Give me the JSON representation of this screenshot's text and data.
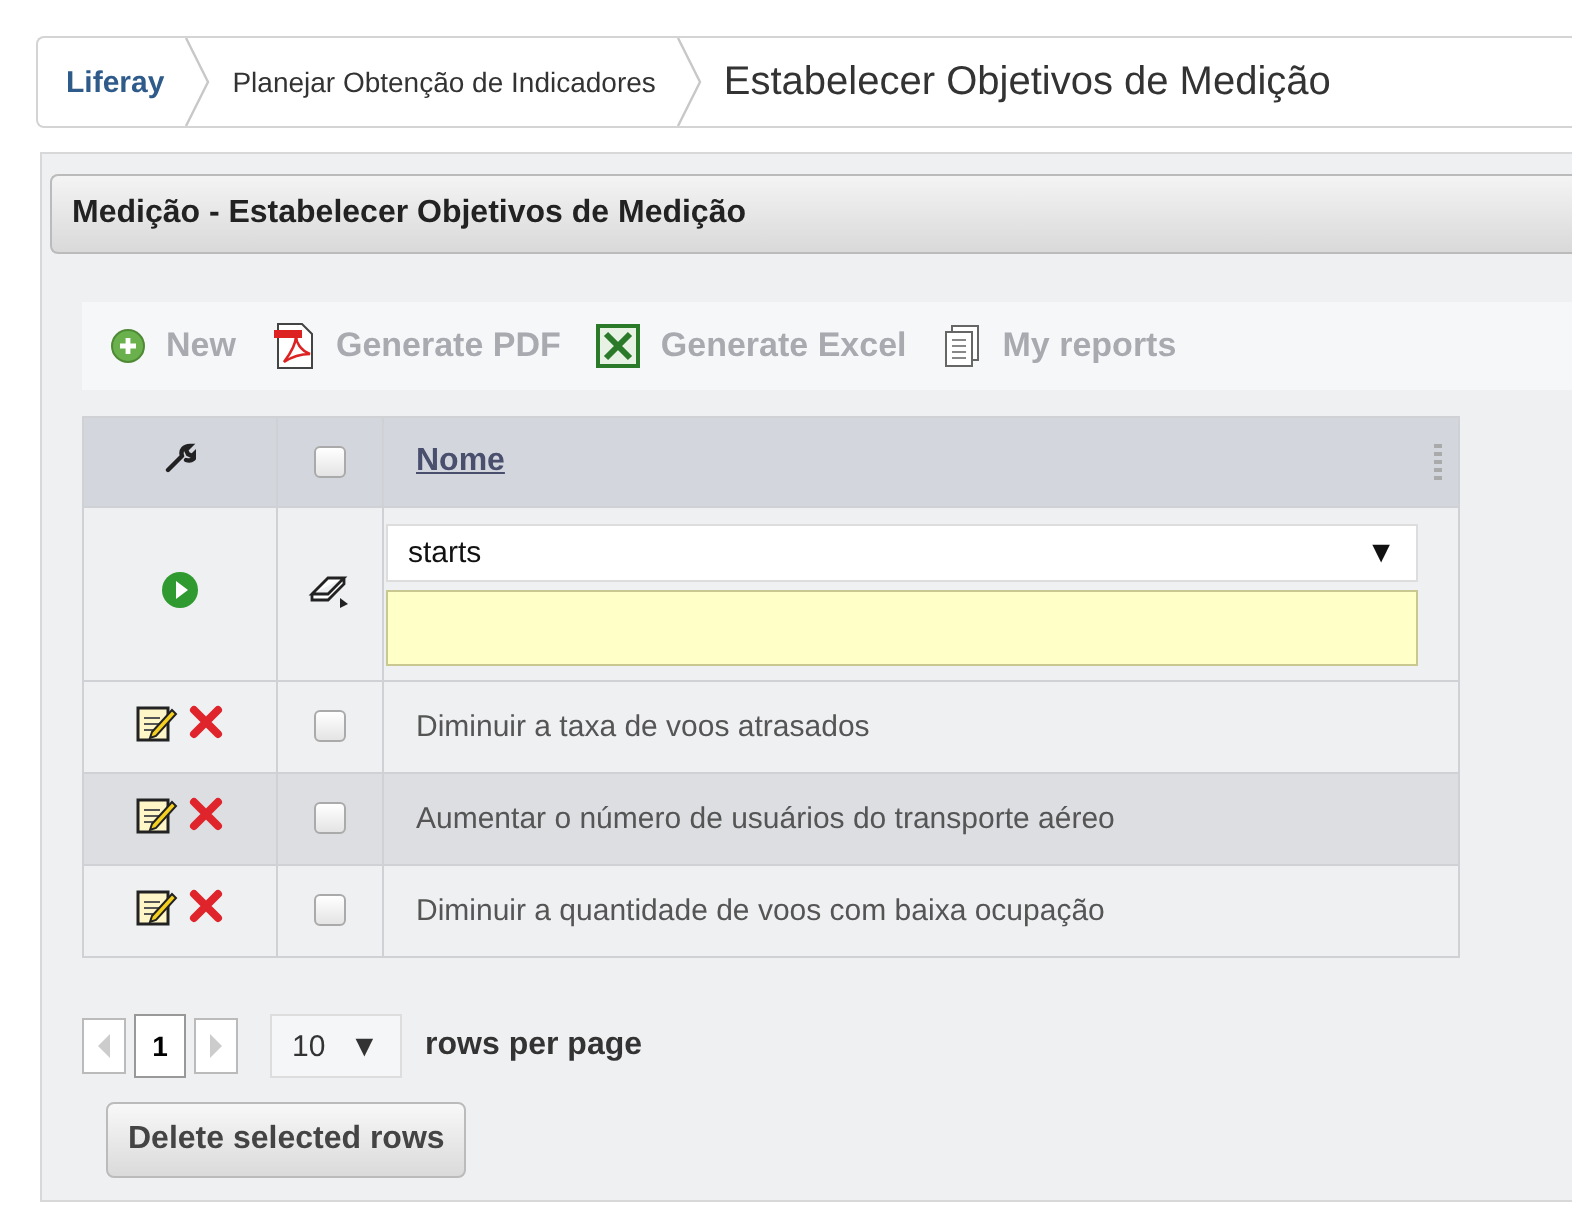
{
  "breadcrumb": [
    {
      "label": "Liferay",
      "kind": "home"
    },
    {
      "label": "Planejar Obtenção de Indicadores",
      "kind": "link"
    },
    {
      "label": "Estabelecer Objetivos de Medição",
      "kind": "current"
    }
  ],
  "panel": {
    "title": "Medição - Estabelecer Objetivos de Medição"
  },
  "toolbar": [
    {
      "label": "New",
      "kind": "new"
    },
    {
      "label": "Generate PDF",
      "kind": "pdf"
    },
    {
      "label": "Generate Excel",
      "kind": "excel"
    },
    {
      "label": "My reports",
      "kind": "reports"
    }
  ],
  "table": {
    "select_all": {
      "checked": false
    },
    "columns": [
      {
        "label": "Nome"
      }
    ],
    "filter": {
      "operator": "starts",
      "arrow": "▼"
    },
    "rows": [
      {
        "nome": "Diminuir a taxa de voos atrasados",
        "checked": false
      },
      {
        "nome": "Aumentar o número de usuários do transporte aéreo",
        "checked": false
      },
      {
        "nome": "Diminuir a quantidade de voos com baixa ocupação",
        "checked": false
      }
    ]
  },
  "pagination": {
    "page": "1",
    "rows_per_page": "10",
    "arrow": "▼",
    "label": "rows per page"
  },
  "buttons": [
    "Delete selected rows"
  ]
}
